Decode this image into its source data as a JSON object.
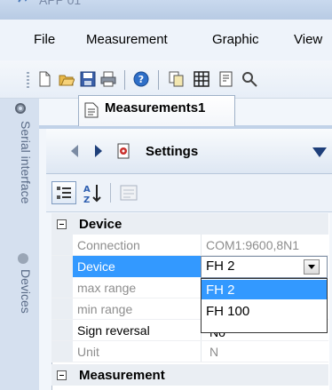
{
  "window": {
    "title": "APP 01"
  },
  "menu": [
    "File",
    "Measurement",
    "Graphic",
    "View"
  ],
  "toolbar": {
    "icons": [
      "new-document-icon",
      "open-folder-icon",
      "save-icon",
      "print-icon",
      "help-icon",
      "copy-icon",
      "table-icon",
      "page-icon",
      "search-icon"
    ]
  },
  "side_tabs": {
    "serial": "Serial interface",
    "devices": "Devices"
  },
  "doc_tab": {
    "label": "Measurements1"
  },
  "settings": {
    "label": "Settings"
  },
  "property_grid": {
    "device_category": "Device",
    "measurement_category": "Measurement",
    "rows": [
      {
        "name": "Connection",
        "value": "COM1:9600,8N1"
      },
      {
        "name": "Device",
        "value": "FH 2"
      },
      {
        "name": "max range",
        "value": ""
      },
      {
        "name": "min range",
        "value": ""
      },
      {
        "name": "Sign reversal",
        "value": "No"
      },
      {
        "name": "Unit",
        "value": "N"
      }
    ],
    "dropdown_options": [
      "FH 2",
      "FH 100"
    ],
    "selected_option": "FH 2"
  },
  "colors": {
    "selection": "#3399ff",
    "chrome": "#dfe8f3"
  }
}
